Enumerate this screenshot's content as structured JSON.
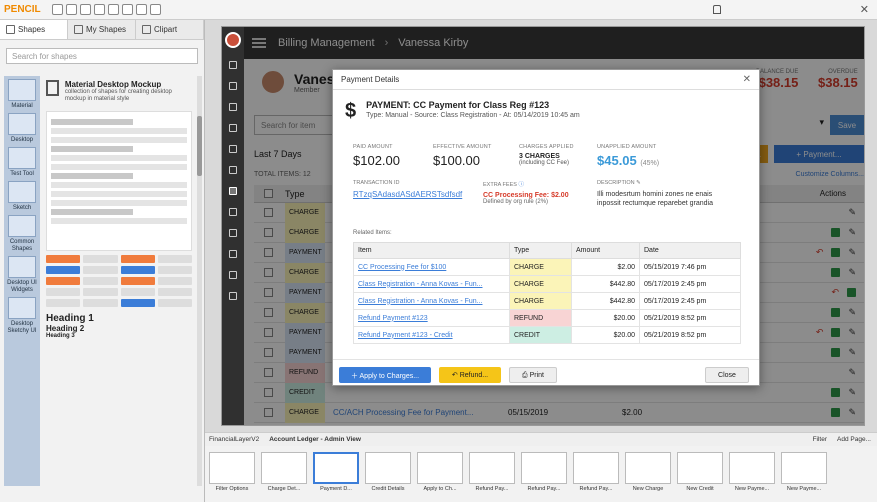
{
  "app": {
    "logo": "PENCIL"
  },
  "left_panel": {
    "tabs": [
      "Shapes",
      "My Shapes",
      "Clipart"
    ],
    "search_placeholder": "Search for shapes",
    "library_title": "Material Desktop Mockup",
    "library_desc": "collection of shapes for creating desktop mockup in material style",
    "categories": [
      "Material",
      "Desktop",
      "Test Tool",
      "Sketch",
      "Common Shapes",
      "Desktop UI Widgets",
      "Desktop Sketchy UI"
    ],
    "headings": [
      "Heading 1",
      "Heading 2",
      "Heading 3"
    ]
  },
  "mockup": {
    "breadcrumb": [
      "Billing Management",
      "Vanessa Kirby"
    ],
    "account_name": "Vanessa",
    "account_sub": "Member",
    "stats": [
      {
        "label": "BALANCE DUE",
        "value": "$38.15"
      },
      {
        "label": "OVERDUE",
        "value": "$38.15"
      }
    ],
    "search_placeholder": "Search for item",
    "save_label": "Save",
    "period": "Last 7 Days",
    "edit_label": "Edit...",
    "payment_label": "+ Payment...",
    "total_items": "TOTAL ITEMS: 12",
    "customize_label": "Customize Columns...",
    "col_type": "Type",
    "col_actions": "Actions",
    "ledger_rows": [
      {
        "type": "CHARGE",
        "cls": "t-charge",
        "desc": "",
        "date": "",
        "amt": "",
        "acts": [
          "pen"
        ]
      },
      {
        "type": "CHARGE",
        "cls": "t-charge",
        "desc": "",
        "date": "",
        "amt": "",
        "acts": [
          "plus",
          "pen"
        ]
      },
      {
        "type": "PAYMENT",
        "cls": "t-payment",
        "desc": "",
        "date": "",
        "amt": "",
        "acts": [
          "undo",
          "plus",
          "pen"
        ]
      },
      {
        "type": "CHARGE",
        "cls": "t-charge",
        "desc": "",
        "date": "",
        "amt": "",
        "acts": [
          "plus",
          "pen"
        ]
      },
      {
        "type": "PAYMENT",
        "cls": "t-payment",
        "desc": "",
        "date": "",
        "amt": "",
        "acts": [
          "undo",
          "plus"
        ]
      },
      {
        "type": "CHARGE",
        "cls": "t-charge",
        "desc": "",
        "date": "",
        "amt": "",
        "acts": [
          "plus",
          "pen"
        ]
      },
      {
        "type": "PAYMENT",
        "cls": "t-payment",
        "desc": "",
        "date": "",
        "amt": "",
        "acts": [
          "undo",
          "plus",
          "pen"
        ]
      },
      {
        "type": "PAYMENT",
        "cls": "t-payment",
        "desc": "",
        "date": "",
        "amt": "",
        "acts": [
          "plus",
          "pen"
        ]
      },
      {
        "type": "REFUND",
        "cls": "t-refund",
        "desc": "",
        "date": "",
        "amt": "",
        "acts": [
          "pen"
        ]
      },
      {
        "type": "CREDIT",
        "cls": "t-credit",
        "desc": "",
        "date": "",
        "amt": "",
        "acts": [
          "plus",
          "pen"
        ]
      },
      {
        "type": "CHARGE",
        "cls": "t-charge",
        "desc": "CC/ACH Processing Fee for Payment...",
        "date": "05/15/2019",
        "amt": "$2.00",
        "acts": [
          "plus",
          "pen"
        ]
      }
    ]
  },
  "modal": {
    "header": "Payment Details",
    "title": "PAYMENT: CC Payment for Class Reg #123",
    "subtitle": "Type: Manual - Source: Class Registration - At: 05/14/2019 10:45 am",
    "stats": {
      "paid_label": "PAID AMOUNT",
      "paid_value": "$102.00",
      "eff_label": "EFFECTIVE AMOUNT",
      "eff_value": "$100.00",
      "charges_label": "CHARGES APPLIED",
      "charges_value": "3 CHARGES",
      "charges_sub": "(including CC Fee)",
      "unapplied_label": "UNAPPLIED AMOUNT",
      "unapplied_value": "$45.05",
      "unapplied_pct": "(45%)"
    },
    "txn_label": "TRANSACTION ID",
    "txn_value": "RTzqSAdasdASdAERSTsdfsdf",
    "extra_label": "EXTRA FEES",
    "extra_value": "CC Processing Fee: $2.00",
    "extra_sub": "Defined by org rule (2%)",
    "desc_label": "DESCRIPTION",
    "desc_value": "Illi modesrtum homini zones ne enais inpossit rectumque reparebet grandia",
    "related_label": "Related Items:",
    "rel_headers": [
      "Item",
      "Type",
      "Amount",
      "Date"
    ],
    "related": [
      {
        "item": "CC Processing Fee for $100",
        "type": "CHARGE",
        "cls": "t-charge",
        "amount": "$2.00",
        "date": "05/15/2019 7:46 pm"
      },
      {
        "item": "Class Registration - Anna Kovas - Fun...",
        "type": "CHARGE",
        "cls": "t-charge",
        "amount": "$442.80",
        "date": "05/17/2019 2:45 pm"
      },
      {
        "item": "Class Registration - Anna Kovas - Fun...",
        "type": "CHARGE",
        "cls": "t-charge",
        "amount": "$442.80",
        "date": "05/17/2019 2:45 pm"
      },
      {
        "item": "Refund Payment #123",
        "type": "REFUND",
        "cls": "t-refund",
        "amount": "$20.00",
        "date": "05/21/2019 8:52 pm"
      },
      {
        "item": "Refund Payment #123 - Credit",
        "type": "CREDIT",
        "cls": "t-credit",
        "amount": "$20.00",
        "date": "05/21/2019 8:52 pm"
      }
    ],
    "btn_apply": "Apply to Charges...",
    "btn_refund": "Refund...",
    "btn_print": "Print",
    "btn_close": "Close"
  },
  "page_bar": {
    "items": [
      "FinancialLayerV2",
      "Account Ledger - Admin View"
    ],
    "right": [
      "Filter",
      "Add Page..."
    ]
  },
  "thumbs": [
    "Filter Options",
    "Charge Det...",
    "Payment D...",
    "Credit Details",
    "Apply to Ch...",
    "Refund Pay...",
    "Refund Pay...",
    "Refund Pay...",
    "New Charge",
    "New Credit",
    "New Payme...",
    "New Payme..."
  ],
  "colors": {
    "accent": "#3b7dd8",
    "warn": "#d63b2a",
    "brand": "#f08a00"
  }
}
